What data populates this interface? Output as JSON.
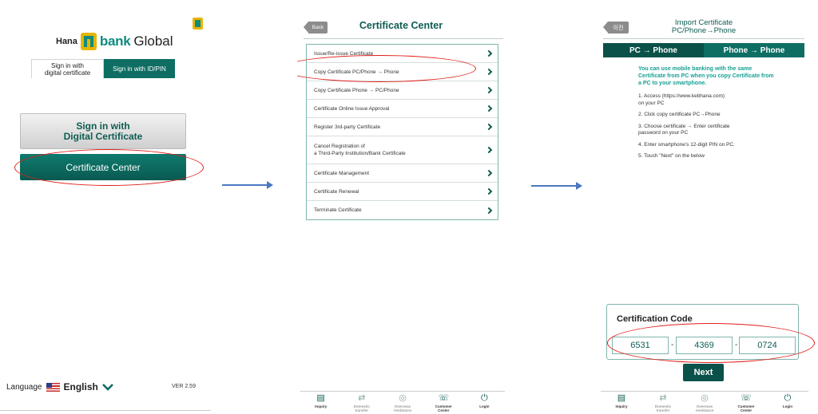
{
  "screen1": {
    "brand": {
      "hana": "Hana",
      "bank": "bank",
      "global": "Global"
    },
    "tabs": {
      "cert": "Sign in with\ndigital certificate",
      "id": "Sign in with ID/PIN"
    },
    "signin_button": "Sign in with\nDigital Certificate",
    "center_button": "Certificate Center",
    "language_label": "Language",
    "language_value": "English",
    "version": "VER 2.59"
  },
  "screen2": {
    "back": "Back",
    "title": "Certificate Center",
    "items": [
      "Issue/Re-issue Certificate",
      "Copy Certificate PC/Phone → Phone",
      "Copy Certificate Phone → PC/Phone",
      "Certificate Online Issue Approval",
      "Register 3rd-party Certificate",
      "Cancel Registration of\na Third-Party Institution/Bank Certificate",
      "Certificate Management",
      "Certificate Renewal",
      "Terminate Certificate"
    ]
  },
  "screen3": {
    "back": "이전",
    "title_line1": "Import Certificate",
    "title_line2": "PC/Phone→Phone",
    "seg": [
      "PC → Phone",
      "Phone → Phone"
    ],
    "intro": "You can use mobile banking with the same Certificate from PC when you copy Certificate from a PC to your smartphone.",
    "steps": [
      "1. Access (https://www.kebhana.com)\n    on your PC",
      "2. Click copy certificate PC→Phone",
      "3. Choose certificate → Enter certificate\n    password on your PC",
      "4. Enter smartphone's 12-digit PIN on PC.",
      "5. Touch \"Next\" on the below"
    ],
    "cert_title": "Certification Code",
    "codes": [
      "6531",
      "4369",
      "0724"
    ],
    "next": "Next"
  },
  "bottom_nav": [
    {
      "label": "Inquiry",
      "icon": "inquiry-icon"
    },
    {
      "label": "Domestic\ntransfer",
      "icon": "domestic-transfer-icon"
    },
    {
      "label": "Overseas\nremittance",
      "icon": "overseas-remittance-icon"
    },
    {
      "label": "Customer\nCenter",
      "icon": "customer-center-icon"
    },
    {
      "label": "Login",
      "icon": "power-icon"
    }
  ],
  "colors": {
    "brand_green": "#0e6e63",
    "highlight_red": "#e0201b",
    "flow_arrow": "#4a78c2"
  }
}
